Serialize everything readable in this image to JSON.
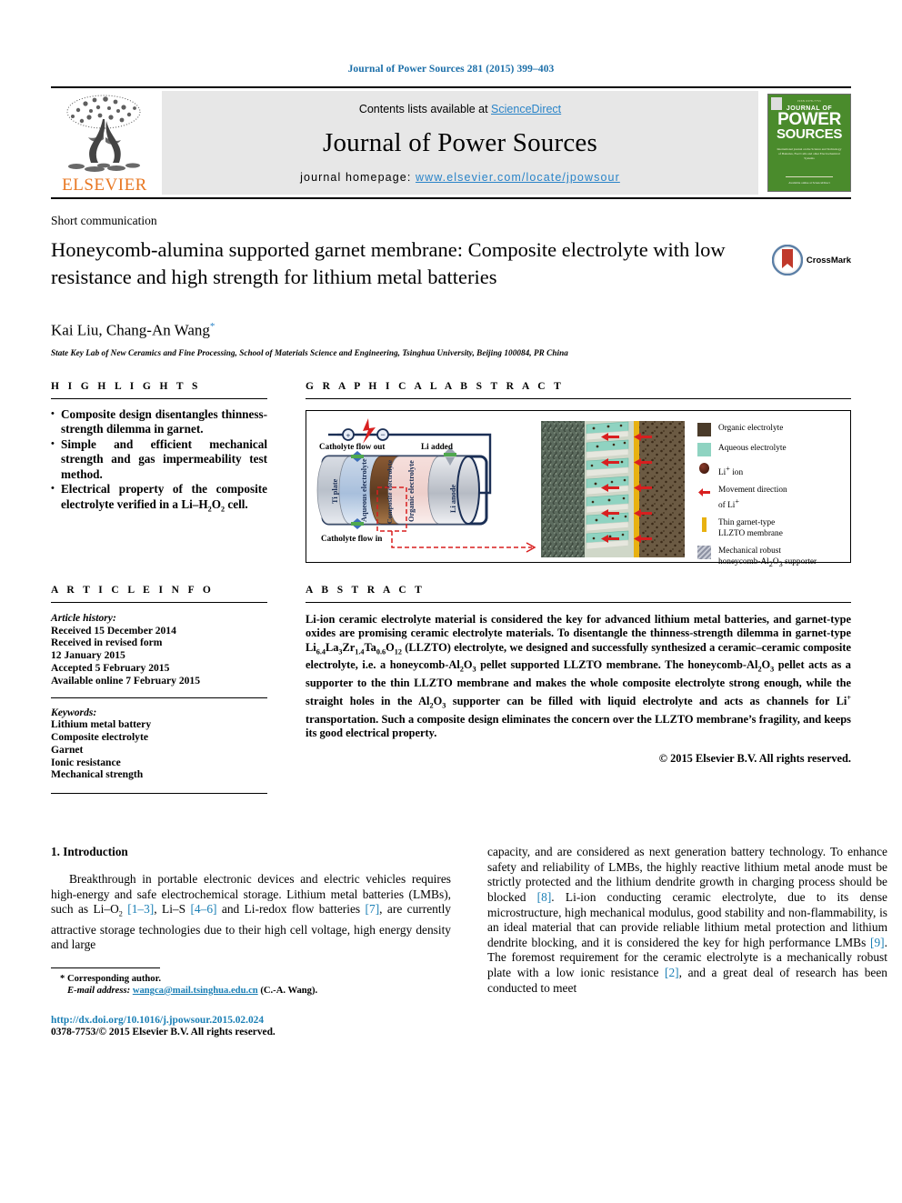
{
  "running_head": "Journal of Power Sources 281 (2015) 399–403",
  "masthead": {
    "contents_prefix": "Contents lists available at ",
    "sciencedirect": "ScienceDirect",
    "journal_name": "Journal of Power Sources",
    "homepage_prefix": "journal homepage: ",
    "homepage_url": "www.elsevier.com/locate/jpowsour",
    "publisher": "ELSEVIER",
    "cover": {
      "top_line": "ISSN 0378-7753",
      "journal_of": "JOURNAL OF",
      "power": "POWER",
      "sources": "SOURCES",
      "blurb": "International journal on the Science and Technology of Batteries, Fuel Cells and other Electrochemical Systems",
      "bottom": "Available online at\nScienceDirect"
    }
  },
  "article": {
    "type": "Short communication",
    "title": "Honeycomb-alumina supported garnet membrane: Composite electrolyte with low resistance and high strength for lithium metal batteries",
    "authors": "Kai Liu, Chang-An Wang",
    "author_marker": "*",
    "affiliation": "State Key Lab of New Ceramics and Fine Processing, School of Materials Science and Engineering, Tsinghua University, Beijing 100084, PR China",
    "crossmark_label": "CrossMark"
  },
  "highlights": {
    "heading": "H I G H L I G H T S",
    "items": [
      "Composite design disentangles thinness-strength dilemma in garnet.",
      "Simple and efficient mechanical strength and gas impermeability test method.",
      "Electrical property of the composite electrolyte verified in a Li–H2O2 cell."
    ]
  },
  "graphical_abstract": {
    "heading": "G R A P H I C A L   A B S T R A C T",
    "figure_labels": {
      "plus": "+",
      "minus": "−",
      "catholyte_out": "Catholyte flow out",
      "li_added": "Li added",
      "catholyte_in": "Catholyte flow in",
      "ti_plate": "Ti plate",
      "aqueous_electrolyte": "Aqueous electrolyte",
      "composite_electrolyte": "Composite electrolyte",
      "organic_electrolyte": "Organic electrolyte",
      "li_anode": "Li anode"
    },
    "legend": [
      {
        "swatch": "organic-electrolyte-swatch",
        "label": "Organic electrolyte"
      },
      {
        "swatch": "aqueous-electrolyte-swatch",
        "label": "Aqueous electrolyte"
      },
      {
        "swatch": "li-ion-swatch",
        "label": "Li+ ion"
      },
      {
        "swatch": "movement-arrow-swatch",
        "label": "Movement direction of Li+"
      },
      {
        "swatch": "garnet-membrane-swatch",
        "label": "Thin garnet-type LLZTO membrane"
      },
      {
        "swatch": "honeycomb-supporter-swatch",
        "label": "Mechanical robust honeycomb-Al2O3 supporter"
      }
    ]
  },
  "article_info": {
    "heading": "A R T I C L E   I N F O",
    "history_label": "Article history:",
    "history": [
      "Received 15 December 2014",
      "Received in revised form",
      "12 January 2015",
      "Accepted 5 February 2015",
      "Available online 7 February 2015"
    ],
    "keywords_label": "Keywords:",
    "keywords": [
      "Lithium metal battery",
      "Composite electrolyte",
      "Garnet",
      "Ionic resistance",
      "Mechanical strength"
    ]
  },
  "abstract": {
    "heading": "A B S T R A C T",
    "copyright": "© 2015 Elsevier B.V. All rights reserved."
  },
  "introduction": {
    "heading": "1.  Introduction"
  },
  "footnote": {
    "corresponding": "Corresponding author.",
    "email_label": "E-mail address:",
    "email": "wangca@mail.tsinghua.edu.cn",
    "email_suffix": "(C.-A. Wang).",
    "doi": "http://dx.doi.org/10.1016/j.jpowsour.2015.02.024",
    "issn": "0378-7753/© 2015 Elsevier B.V. All rights reserved."
  }
}
